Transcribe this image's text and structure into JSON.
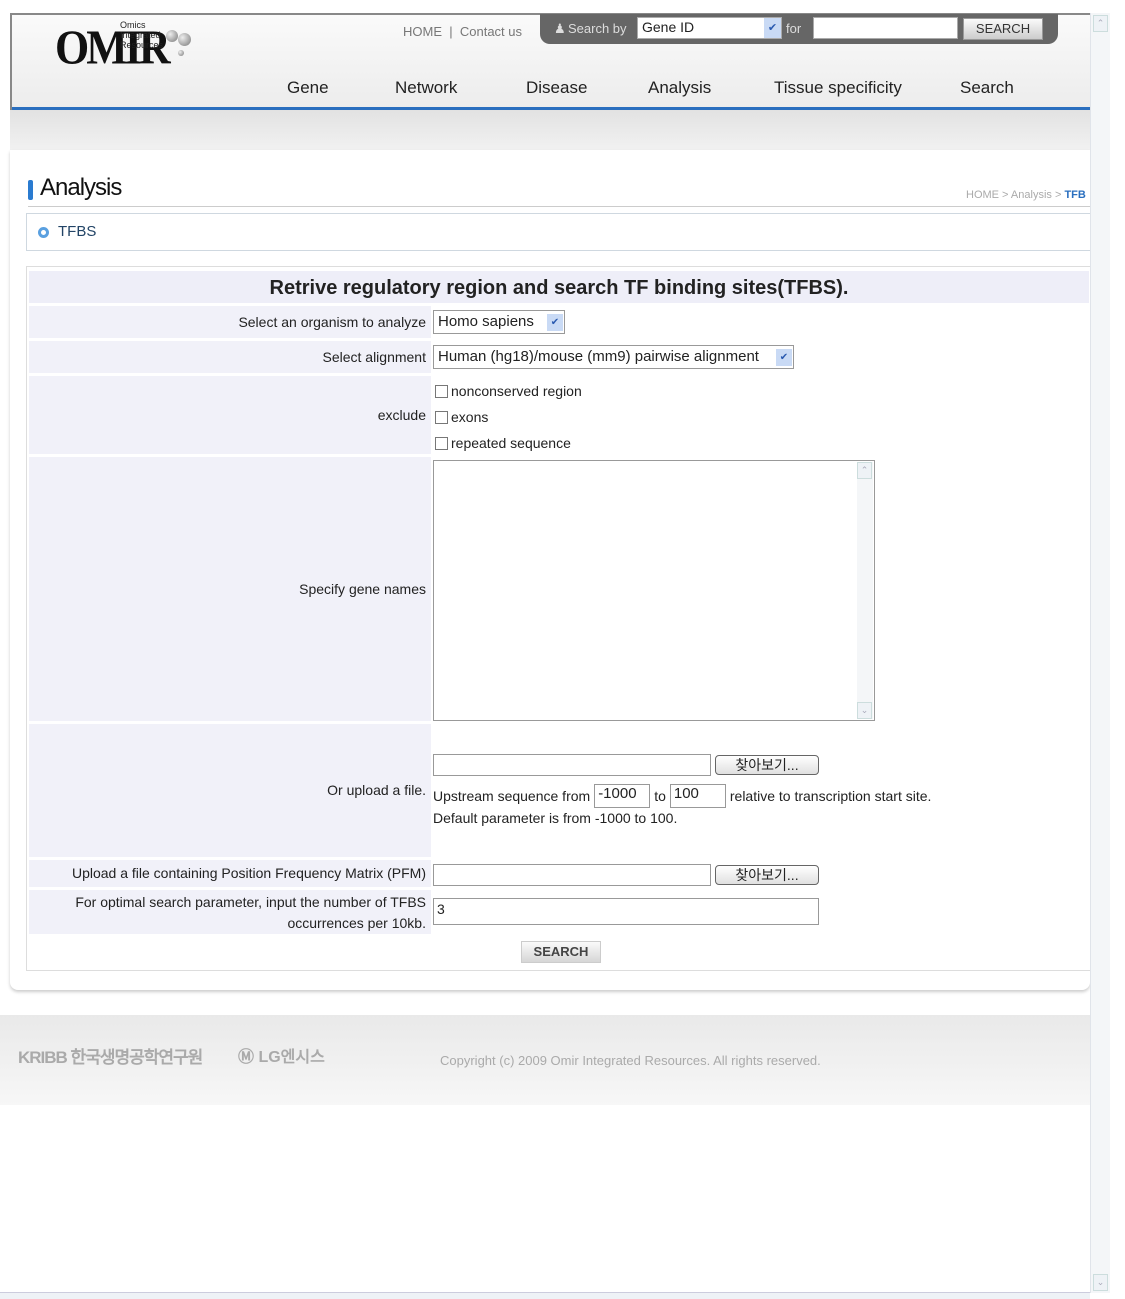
{
  "header": {
    "logo": "OMIR",
    "logo_sub": [
      "Omics",
      "Integrated",
      "Resources"
    ],
    "links": [
      "HOME",
      "Contact us"
    ],
    "search_by_label": "Search by",
    "search_by_value": "Gene ID",
    "for_label": "for",
    "search_input": "",
    "search_button": "SEARCH",
    "nav": [
      "Gene",
      "Network",
      "Disease",
      "Analysis",
      "Tissue specificity",
      "Search"
    ]
  },
  "page": {
    "title": "Analysis",
    "breadcrumb_prefix": "HOME > Analysis > ",
    "breadcrumb_current": "TFB",
    "subtitle": "TFBS"
  },
  "form": {
    "heading": "Retrive regulatory region and search TF binding sites(TFBS).",
    "organism_label": "Select an organism to analyze",
    "organism_value": "Homo sapiens",
    "alignment_label": "Select alignment",
    "alignment_value": "Human (hg18)/mouse (mm9) pairwise alignment",
    "exclude_label": "exclude",
    "exclude_options": [
      {
        "label": "nonconserved region",
        "checked": false
      },
      {
        "label": "exons",
        "checked": false
      },
      {
        "label": "repeated sequence",
        "checked": false
      }
    ],
    "gene_names_label": "Specify gene names",
    "gene_names_value": "",
    "upload_label": "Or upload a file.",
    "browse_button": "찾아보기...",
    "upstream_prefix": "Upstream sequence from",
    "upstream_from": "-1000",
    "to_label": "to",
    "upstream_to": "100",
    "upstream_suffix": "relative to transcription start site.",
    "default_note": "Default parameter is from -1000 to 100.",
    "pfm_label": "Upload a file containing Position Frequency Matrix (PFM)",
    "occurrences_label": "For optimal search parameter, input the number of TFBS occurrences per 10kb.",
    "occurrences_value": "3",
    "submit": "SEARCH"
  },
  "footer": {
    "kribb": "KRIBB 한국생명공학연구원",
    "lg": "LG엔시스",
    "copyright": "Copyright (c) 2009 Omir Integrated Resources. All rights reserved."
  },
  "colors": {
    "accent": "#2a6fbf",
    "label_bg": "#f1f1f9"
  }
}
